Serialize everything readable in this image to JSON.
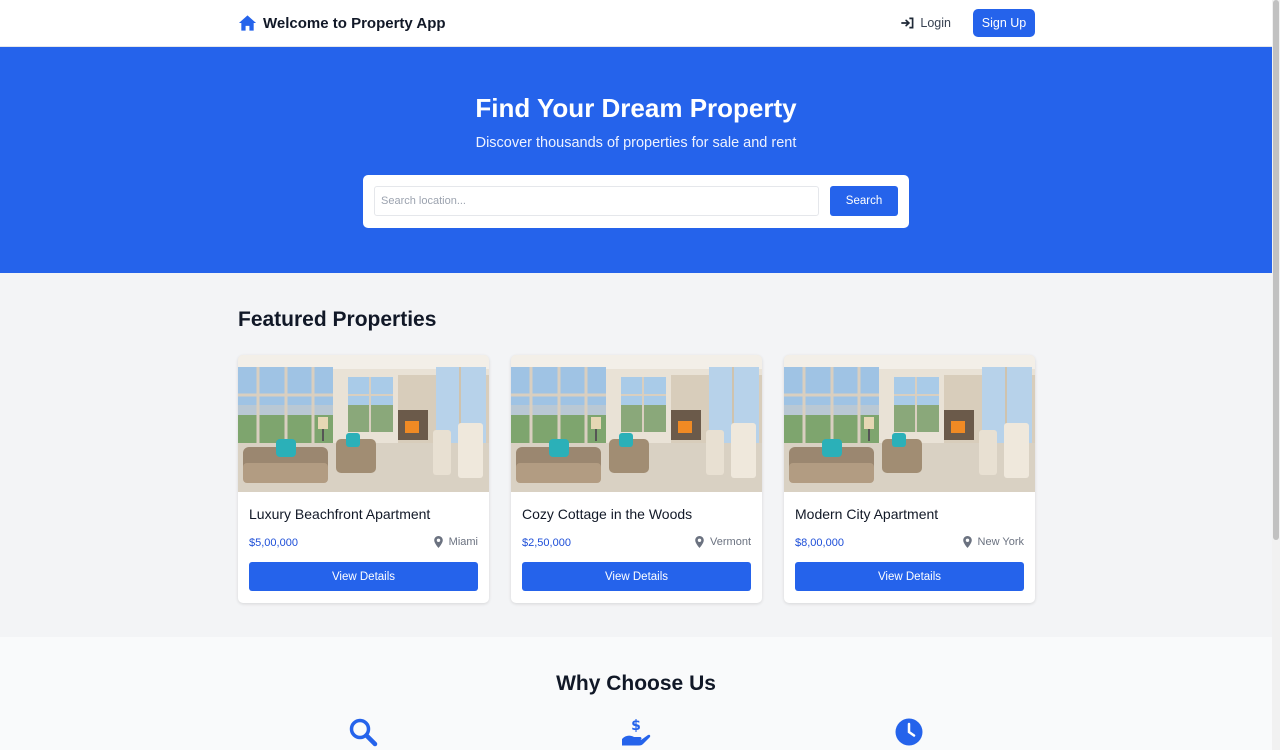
{
  "nav": {
    "brand": "Welcome to Property App",
    "brand_icon": "home-icon",
    "login_label": "Login",
    "login_icon": "sign-in-icon",
    "signup_label": "Sign Up"
  },
  "hero": {
    "title": "Find Your Dream Property",
    "subtitle": "Discover thousands of properties for sale and rent",
    "search_placeholder": "Search location...",
    "search_button": "Search"
  },
  "featured": {
    "title": "Featured Properties",
    "cards": [
      {
        "title": "Luxury Beachfront Apartment",
        "price": "$5,00,000",
        "location": "Miami",
        "button": "View Details"
      },
      {
        "title": "Cozy Cottage in the Woods",
        "price": "$2,50,000",
        "location": "Vermont",
        "button": "View Details"
      },
      {
        "title": "Modern City Apartment",
        "price": "$8,00,000",
        "location": "New York",
        "button": "View Details"
      }
    ]
  },
  "why": {
    "title": "Why Choose Us",
    "icons": [
      "search-icon",
      "hand-dollar-icon",
      "clock-icon"
    ]
  },
  "colors": {
    "primary": "#2563eb",
    "background": "#f3f4f6",
    "price": "#1d4ed8"
  }
}
